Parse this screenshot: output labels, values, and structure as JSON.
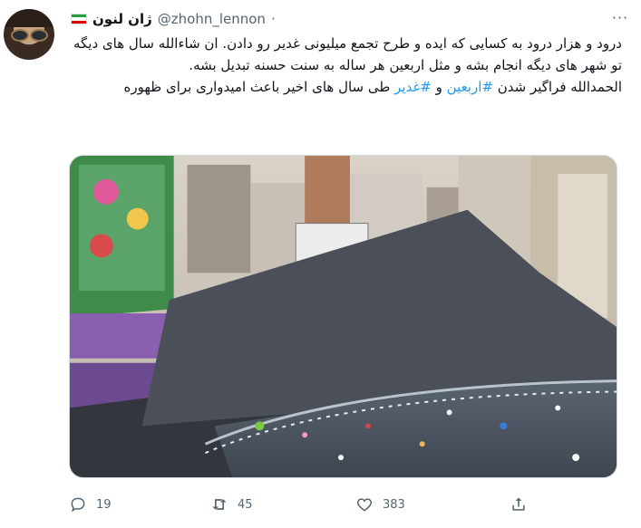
{
  "user": {
    "display_name": "ژان لنون",
    "handle": "@zhohn_lennon",
    "separator": "·",
    "flag_icon": "iran-flag-icon"
  },
  "more_label": "···",
  "tweet": {
    "line1": "درود و هزار درود به کسایی که ایده و طرح تجمع میلیونی غدیر رو دادن. ان شاءالله سال های دیگه تو شهر های دیگه انجام بشه و مثل اربعین هر ساله به سنت حسنه تبدیل بشه.",
    "line2_prefix": "الحمدالله فراگیر شدن ",
    "hashtag1": "#اربعین",
    "conj": " و ",
    "hashtag2": "#غدیر",
    "line2_suffix": " طی سال های اخیر باعث امیدواری برای ظهوره"
  },
  "actions": {
    "reply_count": "19",
    "retweet_count": "45",
    "like_count": "383"
  },
  "colors": {
    "accent": "#1d9bf0",
    "muted": "#536471"
  }
}
